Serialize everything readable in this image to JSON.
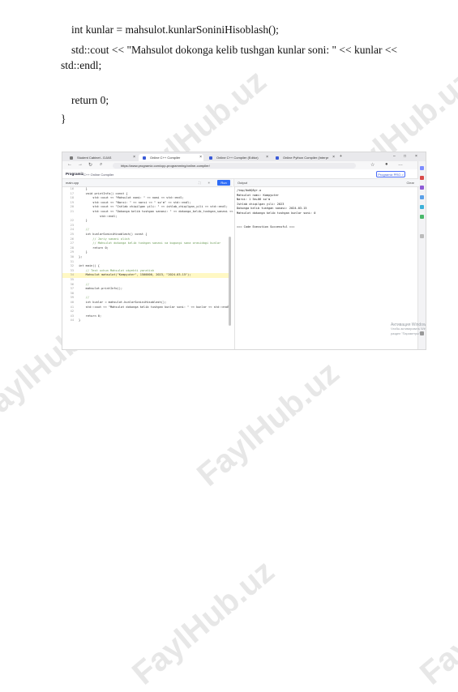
{
  "document": {
    "lines": [
      "int kunlar = mahsulot.kunlarSoniniHisoblash();",
      "std::cout << \"Mahsulot dokonga kelib tushgan kunlar soni: \" << kunlar <<",
      "std::endl;",
      "return 0;",
      "}"
    ]
  },
  "watermark": "FaylHub.uz",
  "browser": {
    "tabs": [
      "Student Cabinet - DJAS",
      "Online C++ Compiler",
      "Online C++ Compiler (Editor)",
      "Online Python Compiler (Interpr"
    ],
    "url": "https://www.programiz.com/cpp-programming/online-compiler/",
    "site_logo": "Programiz",
    "breadcrumb": "C++ Online Compiler",
    "pro_button": "Programiz PRO >",
    "file_name": "main.cpp",
    "run_label": "Run",
    "output_label": "Output",
    "clear_label": "Clear"
  },
  "code_lines": [
    {
      "n": "16",
      "t": "    }"
    },
    {
      "n": "17",
      "t": "    void printInfo() const {"
    },
    {
      "n": "18",
      "t": "        std::cout << \"Mahsulot nomi: \" << nomi << std::endl;"
    },
    {
      "n": "19",
      "t": "        std::cout << \"Narxi: \" << narxi << \" so'm\" << std::endl;"
    },
    {
      "n": "20",
      "t": "        std::cout << \"Ishlab chiqilgan yili: \" << ishlab_chiqilgan_yili << std::endl;"
    },
    {
      "n": "21",
      "t": "        std::cout << \"Dokonga kelib tushgan sanasi: \" << dokonga_kelib_tushgan_sanasi <<"
    },
    {
      "n": "",
      "t": "            std::endl;"
    },
    {
      "n": "22",
      "t": "    }"
    },
    {
      "n": "23",
      "t": ""
    },
    {
      "n": "24",
      "t": "    //"
    },
    {
      "n": "25",
      "t": "    int kunlarSoniniHisoblash() const {"
    },
    {
      "n": "26",
      "t": "        // Joriy sanani olish"
    },
    {
      "n": "27",
      "t": "        // Mahsulot dokonga kelib tushgan sanasi va bugungi sana orasidagi kunlar"
    },
    {
      "n": "28",
      "t": "        return 0;"
    },
    {
      "n": "29",
      "t": "    }"
    },
    {
      "n": "30",
      "t": "};"
    },
    {
      "n": "31",
      "t": ""
    },
    {
      "n": "32",
      "t": "int main() {"
    },
    {
      "n": "33",
      "t": "    // Test uchun Mahsulot obyekti yaratish"
    },
    {
      "n": "34",
      "t": "    Mahsulot mahsulot(\"Kompyuter\", 1500000, 2023, \"2024-03-15\");"
    },
    {
      "n": "35",
      "t": ""
    },
    {
      "n": "36",
      "t": "    //"
    },
    {
      "n": "37",
      "t": "    mahsulot.printInfo();"
    },
    {
      "n": "38",
      "t": ""
    },
    {
      "n": "39",
      "t": "    //"
    },
    {
      "n": "40",
      "t": "    int kunlar = mahsulot.kunlarSoniniHisoblash();"
    },
    {
      "n": "41",
      "t": "    std::cout << \"Mahsulot dokonga kelib tushgan kunlar soni: \" << kunlar << std::endl;"
    },
    {
      "n": "42",
      "t": ""
    },
    {
      "n": "43",
      "t": "    return 0;"
    },
    {
      "n": "44",
      "t": "}"
    }
  ],
  "output_lines": [
    "/tmp/0o0Q8yr.o",
    "Mahsulot nomi: Kompyuter",
    "Narxi: 1 5e+06 so'm",
    "Ishlab chiqilgan yili: 2023",
    "Dokonga kelib tushgan sanasi: 2024-03-15",
    "Mahsulot dokonga kelib tushgan kunlar soni: 0",
    "",
    "",
    "=== Code Execution Successful ==="
  ],
  "activation": [
    "Активация Windows",
    "Чтобы активировать Windows, перейдите в",
    "раздел \"Параметры\"."
  ],
  "colors": {
    "run": "#2f6df6",
    "pro": "#4a6cf7"
  }
}
